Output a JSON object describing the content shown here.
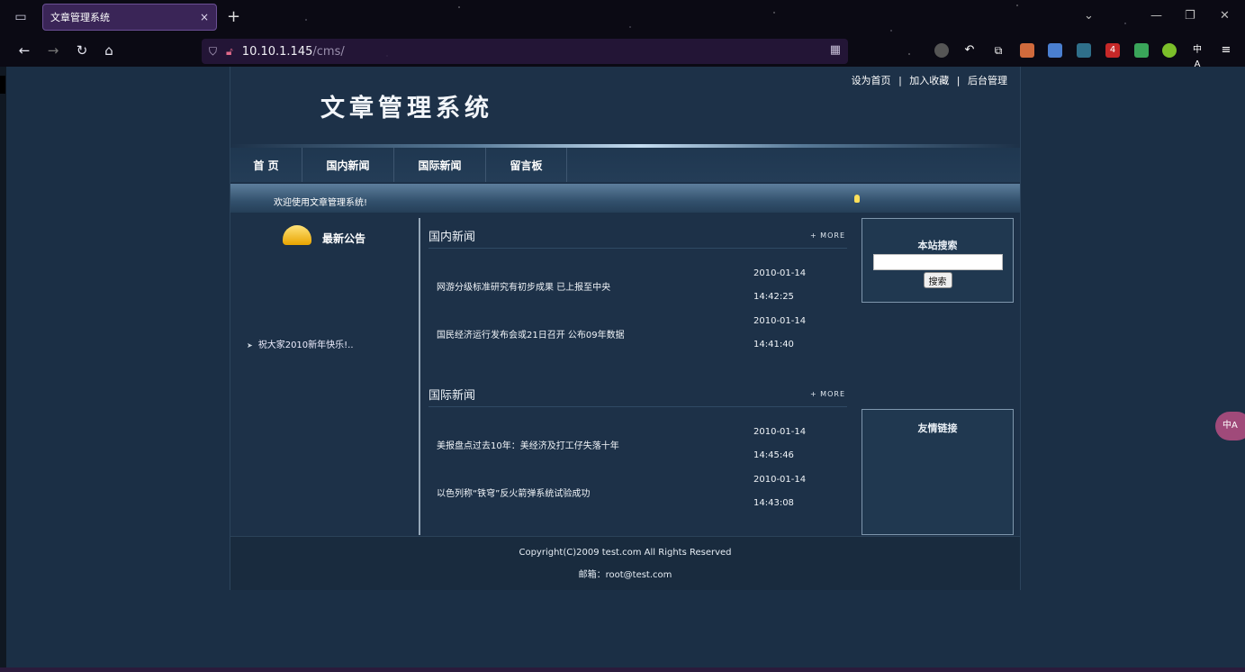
{
  "browser": {
    "tab_title": "文章管理系统",
    "tab_close": "×",
    "new_tab": "+",
    "url_host": "10.10.1.145",
    "url_path": "/cms/",
    "badge_count": "4",
    "translate_label": "中A",
    "icons": [
      "tab-list-icon",
      "back-icon",
      "forward-icon",
      "reload-icon",
      "home-icon",
      "shield-icon",
      "lock-icon",
      "qr-icon",
      "star-icon",
      "minimize-icon",
      "maximize-icon",
      "close-icon"
    ]
  },
  "site": {
    "logo_text": "文章管理系统",
    "top_links": {
      "home": "设为首页",
      "sep": "|",
      "favorite": "加入收藏",
      "admin": "后台管理"
    },
    "nav": [
      "首 页",
      "国内新闻",
      "国际新闻",
      "留言板"
    ],
    "welcome": "欢迎使用文章管理系统!"
  },
  "announcement": {
    "title": "最新公告",
    "items": [
      {
        "text": "祝大家2010新年快乐!.."
      }
    ]
  },
  "sections": [
    {
      "title": "国内新闻",
      "more": "+ MORE",
      "items": [
        {
          "headline": "网游分级标准研究有初步成果 已上报至中央",
          "date": "2010-01-14",
          "time": "14:42:25"
        },
        {
          "headline": "国民经济运行发布会或21日召开 公布09年数据",
          "date": "2010-01-14",
          "time": "14:41:40"
        }
      ]
    },
    {
      "title": "国际新闻",
      "more": "+ MORE",
      "items": [
        {
          "headline": "美报盘点过去10年：美经济及打工仔失落十年",
          "date": "2010-01-14",
          "time": "14:45:46"
        },
        {
          "headline": "以色列称“铁穹”反火箭弹系统试验成功",
          "date": "2010-01-14",
          "time": "14:43:08"
        }
      ]
    }
  ],
  "search": {
    "title": "本站搜索",
    "button": "搜索",
    "value": ""
  },
  "links": {
    "title": "友情链接"
  },
  "footer": {
    "copyright": "Copyright(C)2009 test.com All Rights Reserved",
    "email": "邮箱：root@test.com"
  }
}
